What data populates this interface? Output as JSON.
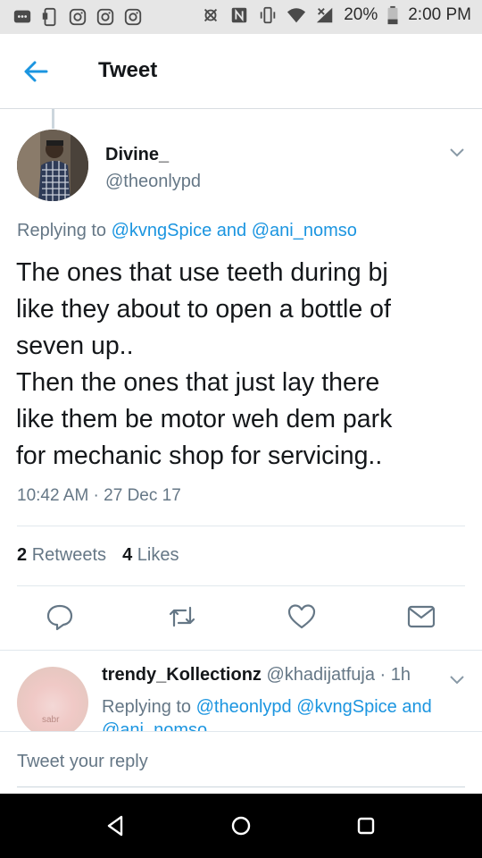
{
  "status_bar": {
    "battery": "20%",
    "time": "2:00 PM",
    "icons_left": [
      "message-icon",
      "phone-icon",
      "instagram-icon",
      "instagram-icon",
      "instagram-icon"
    ],
    "icons_right": [
      "alarm-icon",
      "nfc-icon",
      "vibrate-icon",
      "wifi-icon",
      "signal-icon",
      "battery-icon"
    ]
  },
  "app_bar": {
    "title": "Tweet",
    "back_icon": "back-arrow-icon"
  },
  "tweet": {
    "author_name": "Divine_",
    "author_handle": "@theonlypd",
    "replying_prefix": "Replying to",
    "replying_mention_1": "@kvngSpice",
    "replying_and": "and",
    "replying_mention_2": "@ani_nomso",
    "text": "The ones that use teeth during bj\nlike they about to open a bottle of\nseven up..\nThen the ones that just lay there\nlike them be motor weh dem park\nfor mechanic shop for servicing..",
    "timestamp": "10:42 AM · 27 Dec 17",
    "retweets_count": "2",
    "retweets_label": "Retweets",
    "likes_count": "4",
    "likes_label": "Likes",
    "actions": [
      "reply-icon",
      "retweet-icon",
      "like-icon",
      "message-icon"
    ]
  },
  "reply": {
    "author_name": "trendy_Kollectionz",
    "author_handle": "@khadijatfuja · 1h",
    "avatar_text": "sabr",
    "replying_prefix": "Replying to",
    "replying_mentions": "@theonlypd @kvngSpice and @ani_nomso"
  },
  "composer": {
    "placeholder": "Tweet your reply"
  },
  "colors": {
    "accent": "#1b95e0",
    "secondary_text": "#657786",
    "primary_text": "#14171a",
    "divider": "#e1e8ed",
    "status_bar_bg": "#e6e6e6",
    "nav_bar_bg": "#000000"
  }
}
